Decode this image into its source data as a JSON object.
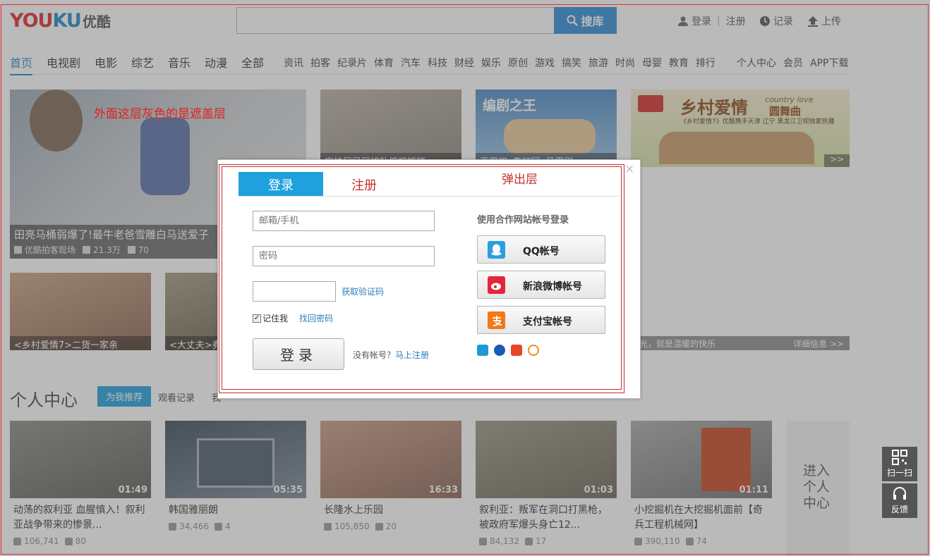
{
  "header": {
    "logo_en_a": "YOU",
    "logo_en_b": "KU",
    "logo_cn": "优酷",
    "search_button": "搜库",
    "login": "登录",
    "register": "注册",
    "history": "记录",
    "upload": "上传"
  },
  "nav": {
    "main": [
      "首页",
      "电视剧",
      "电影",
      "综艺",
      "音乐",
      "动漫",
      "全部"
    ],
    "sub": [
      "资讯",
      "拍客",
      "纪录片",
      "体育",
      "汽车",
      "科技",
      "财经",
      "娱乐",
      "原创",
      "游戏",
      "搞笑",
      "旅游",
      "时尚",
      "母婴",
      "教育",
      "排行"
    ],
    "right": [
      "个人中心",
      "会员",
      "APP下载"
    ]
  },
  "feature": {
    "main_caption": "田亮马桶弱爆了!最牛老爸雪雕白马送爱子",
    "main_source": "优酷拍客现场",
    "main_views": "21.3万",
    "main_comments": "70",
    "top2_caption": "实拍居民区排队俯视抓猪",
    "top3_logo": "编剧之王",
    "top3_caption": "王周权•春钰同•风霏剧",
    "top4_title": "乡村爱情",
    "top4_en": "country love",
    "top4_tag": "圆舞曲",
    "top4_sub": "《乡村爱情7》优酷携手天津 辽宁 黑龙江卫视独家热播",
    "top4_more": ">>",
    "row2_a": "<乡村爱情7>二货一家亲",
    "row2_b": "<大丈夫>券",
    "row2_c": "光，就是温暖的快乐",
    "row2_more": "详细信息 >>"
  },
  "personal": {
    "heading": "个人中心",
    "tab_recommend": "为我推荐",
    "tab_history": "观看记录",
    "tab_more": "我",
    "enter_lines": [
      "进入",
      "个人",
      "中心"
    ]
  },
  "videos": [
    {
      "duration": "01:49",
      "title": "动荡的叙利亚 血腥慎入！叙利亚战争带来的惨景...",
      "views": "106,741",
      "comments": "80"
    },
    {
      "duration": "05:35",
      "title": "韩国雅丽朗",
      "views": "34,466",
      "comments": "4"
    },
    {
      "duration": "16:33",
      "title": "长隆水上乐园",
      "views": "105,850",
      "comments": "20"
    },
    {
      "duration": "01:03",
      "title": "叙利亚：叛军在洞口打黑枪，被政府军爆头身亡12...",
      "views": "84,132",
      "comments": "17"
    },
    {
      "duration": "01:11",
      "title": "小挖掘机在大挖掘机面前【奇兵工程机械网】",
      "views": "390,110",
      "comments": "74"
    }
  ],
  "modal": {
    "tab_login": "登录",
    "tab_register": "注册",
    "email_placeholder": "邮箱/手机",
    "password_placeholder": "密码",
    "get_code": "获取验证码",
    "remember": "记住我",
    "find_password": "找回密码",
    "login_button": "登录",
    "no_account": "没有帐号？",
    "register_now": "马上注册",
    "partner_title": "使用合作网站帐号登录",
    "qq": "QQ帐号",
    "weibo": "新浪微博帐号",
    "alipay": "支付宝帐号",
    "close": "×"
  },
  "annotations": {
    "overlay_note": "外面这层灰色的是遮盖层",
    "popup_note": "弹出层"
  },
  "side_tools": {
    "scan": "扫一扫",
    "feedback": "反馈"
  }
}
